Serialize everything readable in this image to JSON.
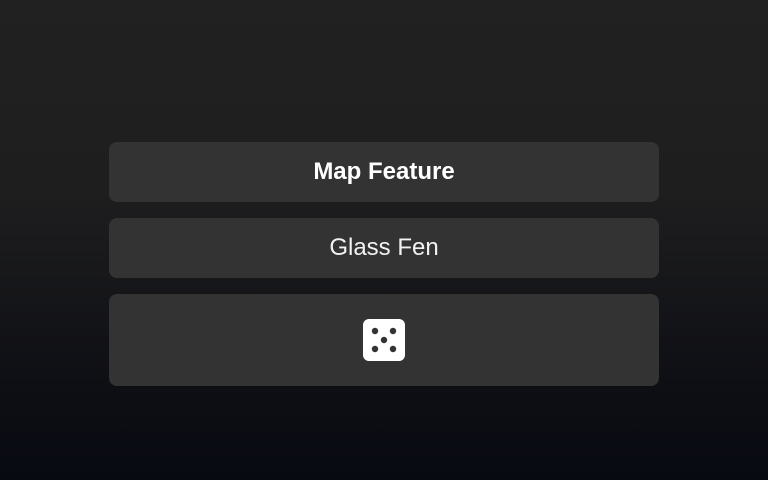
{
  "header": {
    "title": "Map Feature"
  },
  "result": {
    "value": "Glass Fen"
  },
  "roll_button": {
    "icon": "dice-five-icon",
    "face_value": 5
  },
  "colors": {
    "panel": "#333333",
    "text": "#ffffff",
    "die_face": "#ffffff",
    "die_pip": "#333333"
  }
}
